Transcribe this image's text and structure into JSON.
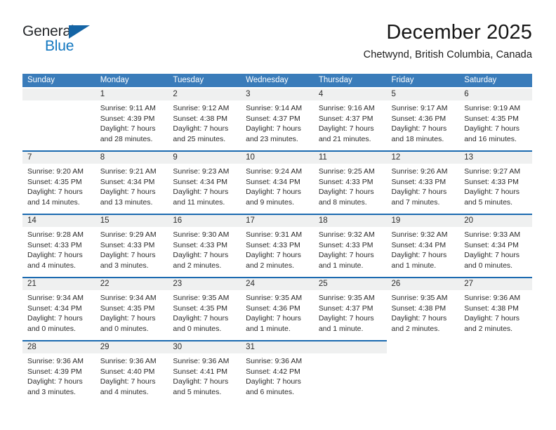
{
  "logo": {
    "word_top": "General",
    "word_bottom": "Blue",
    "triangle_color": "#1464a5"
  },
  "header": {
    "title": "December 2025",
    "subtitle": "Chetwynd, British Columbia, Canada"
  },
  "theme": {
    "header_bg": "#3a7cba",
    "separator": "#1b6ab0",
    "daynum_bg": "#eff0f0"
  },
  "weekdays": [
    "Sunday",
    "Monday",
    "Tuesday",
    "Wednesday",
    "Thursday",
    "Friday",
    "Saturday"
  ],
  "weeks": [
    [
      {
        "day": "",
        "lines": []
      },
      {
        "day": "1",
        "lines": [
          "Sunrise: 9:11 AM",
          "Sunset: 4:39 PM",
          "Daylight: 7 hours",
          "and 28 minutes."
        ]
      },
      {
        "day": "2",
        "lines": [
          "Sunrise: 9:12 AM",
          "Sunset: 4:38 PM",
          "Daylight: 7 hours",
          "and 25 minutes."
        ]
      },
      {
        "day": "3",
        "lines": [
          "Sunrise: 9:14 AM",
          "Sunset: 4:37 PM",
          "Daylight: 7 hours",
          "and 23 minutes."
        ]
      },
      {
        "day": "4",
        "lines": [
          "Sunrise: 9:16 AM",
          "Sunset: 4:37 PM",
          "Daylight: 7 hours",
          "and 21 minutes."
        ]
      },
      {
        "day": "5",
        "lines": [
          "Sunrise: 9:17 AM",
          "Sunset: 4:36 PM",
          "Daylight: 7 hours",
          "and 18 minutes."
        ]
      },
      {
        "day": "6",
        "lines": [
          "Sunrise: 9:19 AM",
          "Sunset: 4:35 PM",
          "Daylight: 7 hours",
          "and 16 minutes."
        ]
      }
    ],
    [
      {
        "day": "7",
        "lines": [
          "Sunrise: 9:20 AM",
          "Sunset: 4:35 PM",
          "Daylight: 7 hours",
          "and 14 minutes."
        ]
      },
      {
        "day": "8",
        "lines": [
          "Sunrise: 9:21 AM",
          "Sunset: 4:34 PM",
          "Daylight: 7 hours",
          "and 13 minutes."
        ]
      },
      {
        "day": "9",
        "lines": [
          "Sunrise: 9:23 AM",
          "Sunset: 4:34 PM",
          "Daylight: 7 hours",
          "and 11 minutes."
        ]
      },
      {
        "day": "10",
        "lines": [
          "Sunrise: 9:24 AM",
          "Sunset: 4:34 PM",
          "Daylight: 7 hours",
          "and 9 minutes."
        ]
      },
      {
        "day": "11",
        "lines": [
          "Sunrise: 9:25 AM",
          "Sunset: 4:33 PM",
          "Daylight: 7 hours",
          "and 8 minutes."
        ]
      },
      {
        "day": "12",
        "lines": [
          "Sunrise: 9:26 AM",
          "Sunset: 4:33 PM",
          "Daylight: 7 hours",
          "and 7 minutes."
        ]
      },
      {
        "day": "13",
        "lines": [
          "Sunrise: 9:27 AM",
          "Sunset: 4:33 PM",
          "Daylight: 7 hours",
          "and 5 minutes."
        ]
      }
    ],
    [
      {
        "day": "14",
        "lines": [
          "Sunrise: 9:28 AM",
          "Sunset: 4:33 PM",
          "Daylight: 7 hours",
          "and 4 minutes."
        ]
      },
      {
        "day": "15",
        "lines": [
          "Sunrise: 9:29 AM",
          "Sunset: 4:33 PM",
          "Daylight: 7 hours",
          "and 3 minutes."
        ]
      },
      {
        "day": "16",
        "lines": [
          "Sunrise: 9:30 AM",
          "Sunset: 4:33 PM",
          "Daylight: 7 hours",
          "and 2 minutes."
        ]
      },
      {
        "day": "17",
        "lines": [
          "Sunrise: 9:31 AM",
          "Sunset: 4:33 PM",
          "Daylight: 7 hours",
          "and 2 minutes."
        ]
      },
      {
        "day": "18",
        "lines": [
          "Sunrise: 9:32 AM",
          "Sunset: 4:33 PM",
          "Daylight: 7 hours",
          "and 1 minute."
        ]
      },
      {
        "day": "19",
        "lines": [
          "Sunrise: 9:32 AM",
          "Sunset: 4:34 PM",
          "Daylight: 7 hours",
          "and 1 minute."
        ]
      },
      {
        "day": "20",
        "lines": [
          "Sunrise: 9:33 AM",
          "Sunset: 4:34 PM",
          "Daylight: 7 hours",
          "and 0 minutes."
        ]
      }
    ],
    [
      {
        "day": "21",
        "lines": [
          "Sunrise: 9:34 AM",
          "Sunset: 4:34 PM",
          "Daylight: 7 hours",
          "and 0 minutes."
        ]
      },
      {
        "day": "22",
        "lines": [
          "Sunrise: 9:34 AM",
          "Sunset: 4:35 PM",
          "Daylight: 7 hours",
          "and 0 minutes."
        ]
      },
      {
        "day": "23",
        "lines": [
          "Sunrise: 9:35 AM",
          "Sunset: 4:35 PM",
          "Daylight: 7 hours",
          "and 0 minutes."
        ]
      },
      {
        "day": "24",
        "lines": [
          "Sunrise: 9:35 AM",
          "Sunset: 4:36 PM",
          "Daylight: 7 hours",
          "and 1 minute."
        ]
      },
      {
        "day": "25",
        "lines": [
          "Sunrise: 9:35 AM",
          "Sunset: 4:37 PM",
          "Daylight: 7 hours",
          "and 1 minute."
        ]
      },
      {
        "day": "26",
        "lines": [
          "Sunrise: 9:35 AM",
          "Sunset: 4:38 PM",
          "Daylight: 7 hours",
          "and 2 minutes."
        ]
      },
      {
        "day": "27",
        "lines": [
          "Sunrise: 9:36 AM",
          "Sunset: 4:38 PM",
          "Daylight: 7 hours",
          "and 2 minutes."
        ]
      }
    ],
    [
      {
        "day": "28",
        "lines": [
          "Sunrise: 9:36 AM",
          "Sunset: 4:39 PM",
          "Daylight: 7 hours",
          "and 3 minutes."
        ]
      },
      {
        "day": "29",
        "lines": [
          "Sunrise: 9:36 AM",
          "Sunset: 4:40 PM",
          "Daylight: 7 hours",
          "and 4 minutes."
        ]
      },
      {
        "day": "30",
        "lines": [
          "Sunrise: 9:36 AM",
          "Sunset: 4:41 PM",
          "Daylight: 7 hours",
          "and 5 minutes."
        ]
      },
      {
        "day": "31",
        "lines": [
          "Sunrise: 9:36 AM",
          "Sunset: 4:42 PM",
          "Daylight: 7 hours",
          "and 6 minutes."
        ]
      },
      {
        "day": "",
        "lines": []
      },
      {
        "day": "",
        "lines": []
      },
      {
        "day": "",
        "lines": []
      }
    ]
  ]
}
